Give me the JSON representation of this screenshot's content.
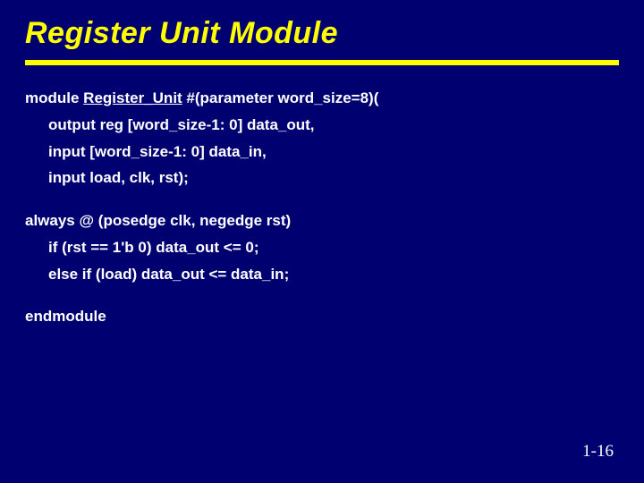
{
  "title": "Register Unit Module",
  "code": {
    "decl_pre": "module ",
    "decl_name": "Register_Unit",
    "decl_post": " #(parameter word_size=8)(",
    "port_out": "output reg [word_size-1: 0]  data_out,",
    "port_in": "input [word_size-1: 0]  data_in,",
    "port_ctl": "input load, clk, rst);",
    "always": "always @ (posedge clk, negedge rst)",
    "if_line": "if (rst == 1'b 0) data_out <= 0;",
    "else_line": "else if (load) data_out <= data_in;",
    "endmod": "endmodule"
  },
  "pagenum": "1-16"
}
